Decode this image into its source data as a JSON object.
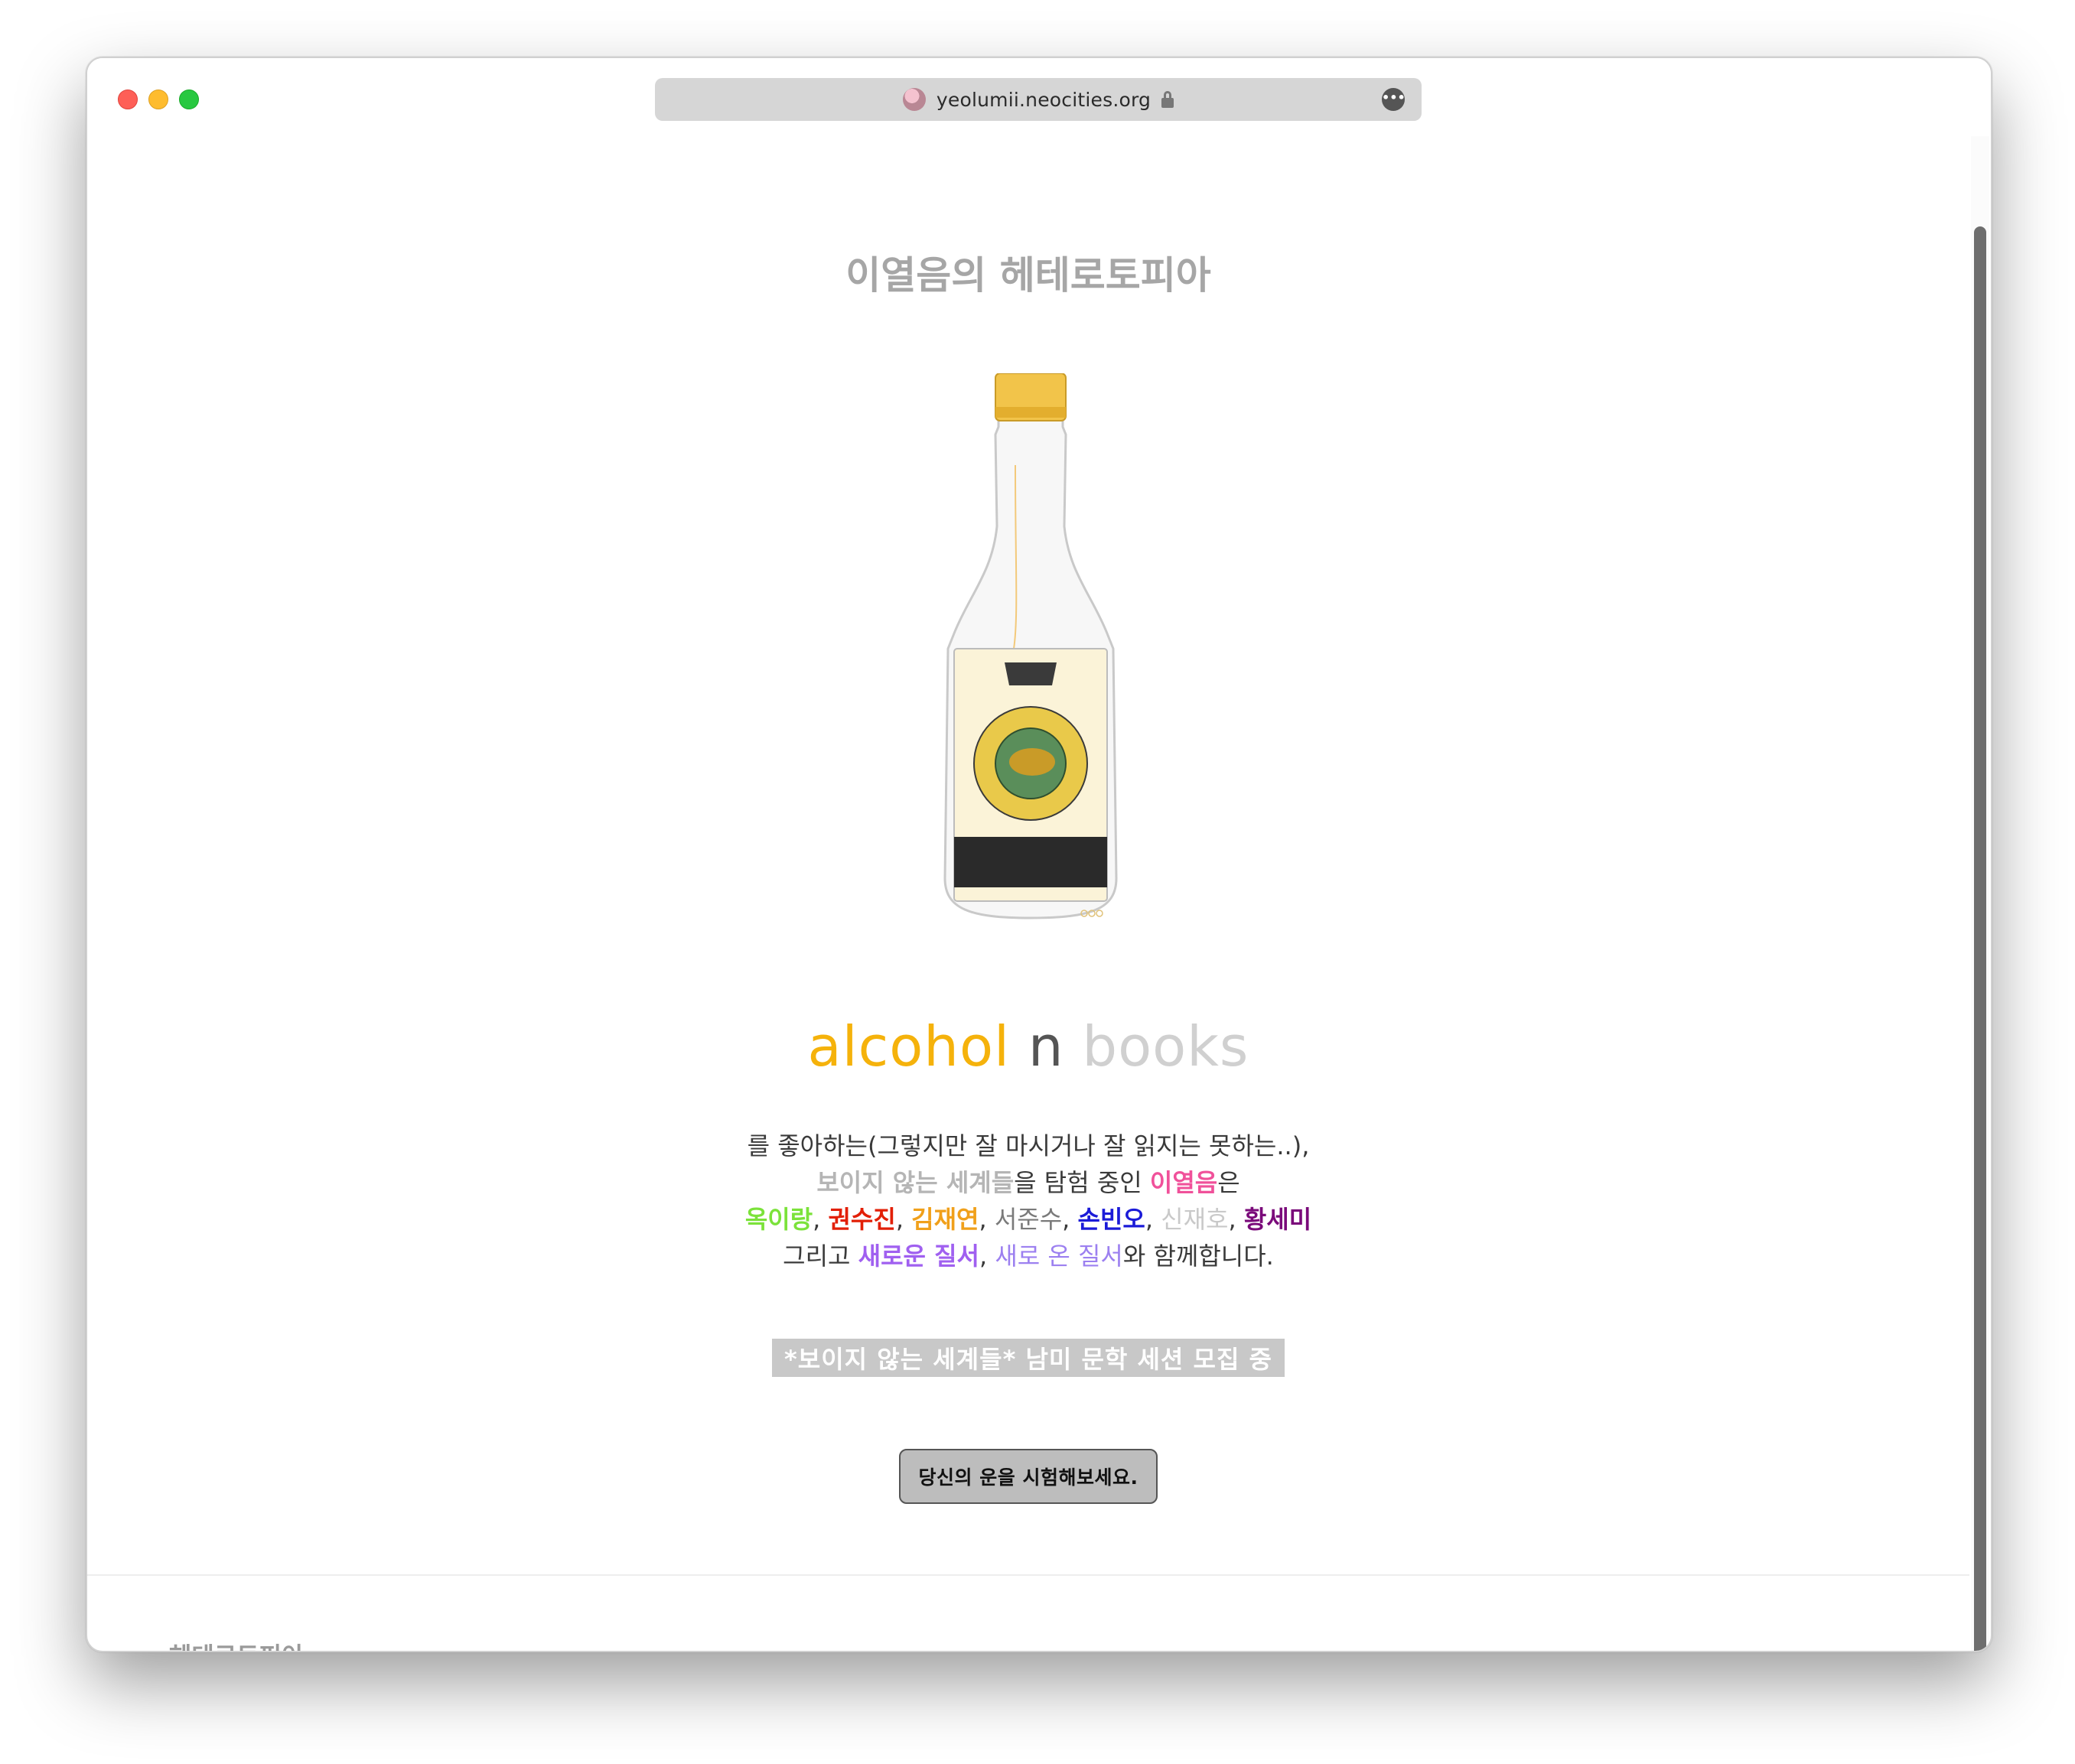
{
  "browser": {
    "url": "yeolumii.neocities.org"
  },
  "page": {
    "title": "이열음의 헤테로토피아",
    "brand": {
      "alcohol": "alcohol",
      "n": "n",
      "books": "books"
    },
    "description": {
      "line1": "를 좋아하는(그렇지만 잘 마시거나 잘 읽지는 못하는..),",
      "line2": {
        "worlds": "보이지 않는 세계들",
        "mid": "을 탐험 중인 ",
        "name": "이열음",
        "end": "은"
      },
      "members": [
        "옥이랑",
        "권수진",
        "김재연",
        "서준수",
        "손빈오",
        "신재호",
        "황세미"
      ],
      "comma": ", ",
      "line4": {
        "start": "그리고 ",
        "order1": "새로운 질서",
        "comma": ", ",
        "order2": "새로 온 질서",
        "end": "와 함께합니다."
      }
    },
    "recruit": "*보이지 않는 세계들* 남미 문학 세션 모집 중",
    "luck_button": "당신의 운을 시험해보세요.",
    "footer_toggle": "헤테로토피아"
  }
}
